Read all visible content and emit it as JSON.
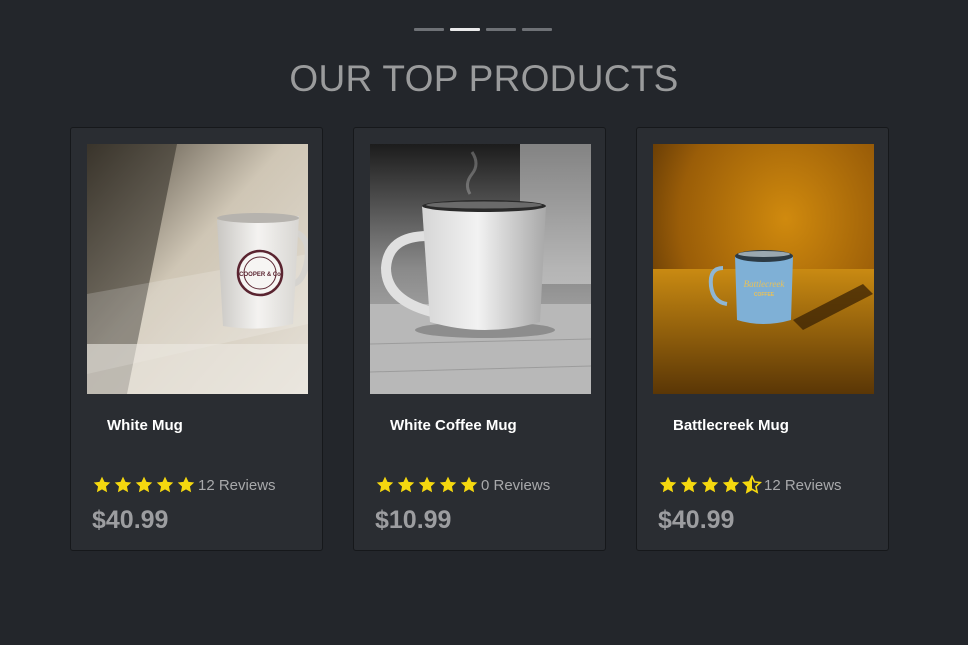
{
  "carousel": {
    "slides": 4,
    "active_index": 1
  },
  "section": {
    "title": "OUR TOP PRODUCTS"
  },
  "colors": {
    "background": "#23262b",
    "card": "#2a2d32",
    "star": "#f5d80f",
    "title": "#9a9b9c"
  },
  "products": [
    {
      "name": "White Mug",
      "rating": 5,
      "reviews": "12 Reviews",
      "price": "$40.99",
      "image": "white-mug-photo"
    },
    {
      "name": "White Coffee Mug",
      "rating": 5,
      "reviews": "0 Reviews",
      "price": "$10.99",
      "image": "white-coffee-mug-photo"
    },
    {
      "name": "Battlecreek Mug",
      "rating": 4.5,
      "reviews": "12 Reviews",
      "price": "$40.99",
      "image": "battlecreek-mug-photo"
    }
  ],
  "mug_prints": {
    "white_mug": [
      "COFFEE ROASTERS",
      "COOPER & Co",
      "EST. 2016"
    ],
    "battlecreek_mug": [
      "Battlecreek",
      "COFFEE"
    ]
  }
}
